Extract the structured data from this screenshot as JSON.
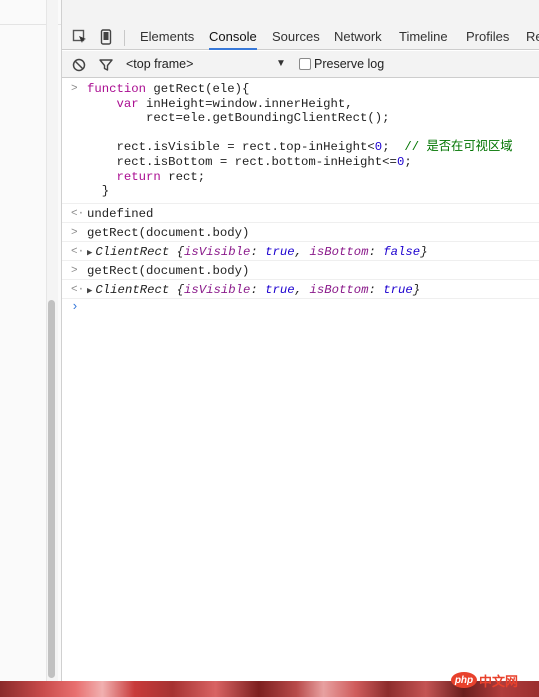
{
  "toolbar_tabs": [
    {
      "label": "Elements"
    },
    {
      "label": "Console"
    },
    {
      "label": "Sources"
    },
    {
      "label": "Network"
    },
    {
      "label": "Timeline"
    },
    {
      "label": "Profiles"
    },
    {
      "label": "Re"
    }
  ],
  "active_tab": "Console",
  "console_toolbar": {
    "frame": "<top frame>",
    "preserve_log_label": "Preserve log",
    "preserve_log_checked": false
  },
  "console": {
    "input1": {
      "lines": [
        {
          "parts": [
            {
              "t": "kw",
              "v": "function"
            },
            {
              "t": "",
              "v": " getRect(ele){"
            }
          ]
        },
        {
          "parts": [
            {
              "t": "",
              "v": "    "
            },
            {
              "t": "kw",
              "v": "var"
            },
            {
              "t": "",
              "v": " inHeight=window.innerHeight,"
            }
          ]
        },
        {
          "parts": [
            {
              "t": "",
              "v": "        rect=ele.getBoundingClientRect();"
            }
          ]
        },
        {
          "parts": [
            {
              "t": "",
              "v": ""
            }
          ]
        },
        {
          "parts": [
            {
              "t": "",
              "v": "    rect.isVisible = rect.top-inHeight<"
            },
            {
              "t": "num",
              "v": "0"
            },
            {
              "t": "",
              "v": ";  "
            },
            {
              "t": "cmt",
              "v": "// 是否在可视区域"
            }
          ]
        },
        {
          "parts": [
            {
              "t": "",
              "v": "    rect.isBottom = rect.bottom-inHeight<="
            },
            {
              "t": "num",
              "v": "0"
            },
            {
              "t": "",
              "v": ";"
            }
          ]
        },
        {
          "parts": [
            {
              "t": "",
              "v": "    "
            },
            {
              "t": "kw",
              "v": "return"
            },
            {
              "t": "",
              "v": " rect;"
            }
          ]
        },
        {
          "parts": [
            {
              "t": "",
              "v": "  }"
            }
          ]
        }
      ]
    },
    "result1": "undefined",
    "input2": "getRect(document.body)",
    "result2": {
      "type": "ClientRect",
      "isVisible": "true",
      "isBottom": "false"
    },
    "input3": "getRect(document.body)",
    "result3": {
      "type": "ClientRect",
      "isVisible": "true",
      "isBottom": "true"
    }
  },
  "watermark": {
    "php": "php",
    "cn": "中文网"
  },
  "icons": {
    "inspect": "inspect-element-icon",
    "device": "device-mode-icon",
    "clear": "clear-console-icon",
    "filter": "filter-icon"
  }
}
